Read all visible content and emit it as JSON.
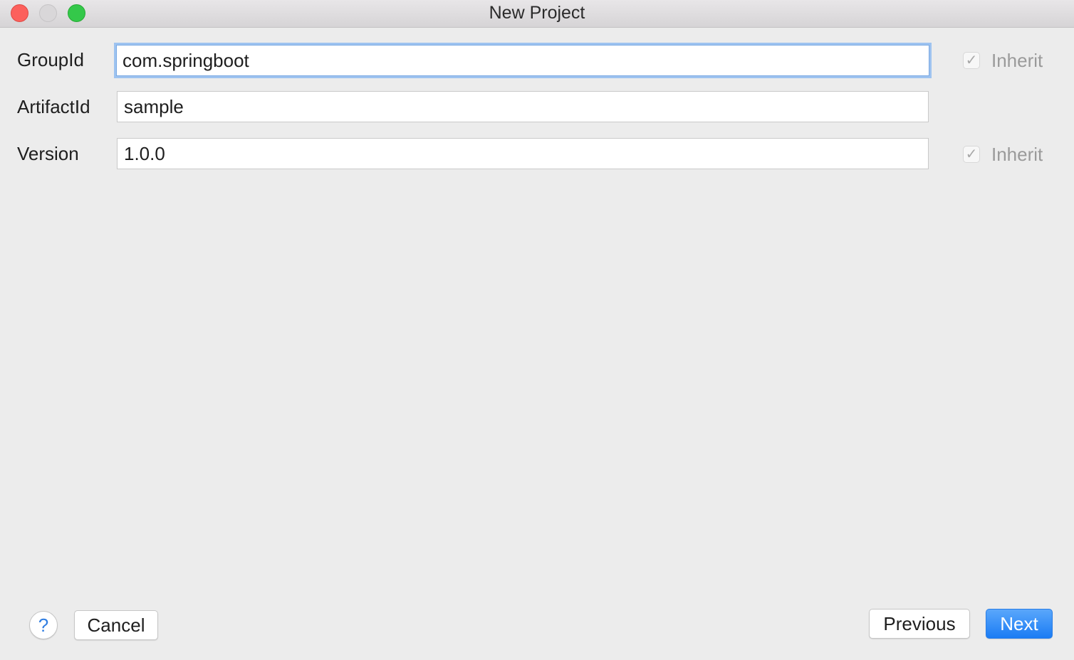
{
  "window": {
    "title": "New Project"
  },
  "form": {
    "group_id": {
      "label": "GroupId",
      "value": "com.springboot",
      "inherit_label": "Inherit",
      "inherit_checked": true
    },
    "artifact_id": {
      "label": "ArtifactId",
      "value": "sample"
    },
    "version": {
      "label": "Version",
      "value": "1.0.0",
      "inherit_label": "Inherit",
      "inherit_checked": true
    }
  },
  "footer": {
    "help_glyph": "?",
    "cancel_label": "Cancel",
    "previous_label": "Previous",
    "next_label": "Next"
  },
  "icons": {
    "check_glyph": "✓"
  },
  "colors": {
    "accent": "#1b7cf4",
    "focus_ring": "#9ec3f0",
    "close": "#fc605c",
    "maximize": "#34c84a"
  }
}
